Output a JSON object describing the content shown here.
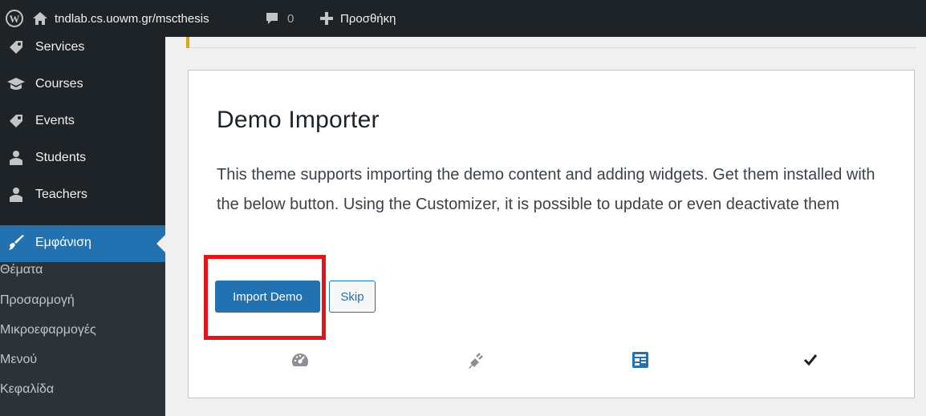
{
  "adminbar": {
    "logo_icon": "wordpress-logo-icon",
    "site_icon": "home-icon",
    "site_name": "tndlab.cs.uowm.gr/mscthesis",
    "comments_icon": "comment-bubble-icon",
    "comments_count": "0",
    "new_icon": "plus-icon",
    "new_label": "Προσθήκη"
  },
  "sidebar": {
    "items": [
      {
        "label": "Services",
        "icon": "tag-icon"
      },
      {
        "label": "Courses",
        "icon": "graduation-cap-icon"
      },
      {
        "label": "Events",
        "icon": "tag-icon"
      },
      {
        "label": "Students",
        "icon": "users-icon"
      },
      {
        "label": "Teachers",
        "icon": "users-icon"
      }
    ],
    "active": {
      "label": "Εμφάνιση",
      "icon": "paintbrush-icon"
    },
    "submenu": [
      "Θέματα",
      "Προσαρμογή",
      "Μικροεφαρμογές",
      "Μενού",
      "Κεφαλίδα"
    ]
  },
  "importer": {
    "title": "Demo Importer",
    "description": "This theme supports importing the demo content and adding widgets. Get them installed with the below button. Using the Customizer, it is possible to update or even deactivate them",
    "import_label": "Import Demo",
    "skip_label": "Skip",
    "steps": [
      {
        "icon": "dashboard-icon",
        "color": "#8c8f94"
      },
      {
        "icon": "plugin-icon",
        "color": "#8c8f94"
      },
      {
        "icon": "widgets-icon",
        "color": "#2271b1"
      },
      {
        "icon": "checkmark-icon",
        "color": "#1d2327"
      }
    ]
  },
  "colors": {
    "admin_dark": "#1d2327",
    "accent_blue": "#2271b1",
    "highlight_red": "#e3141b"
  }
}
